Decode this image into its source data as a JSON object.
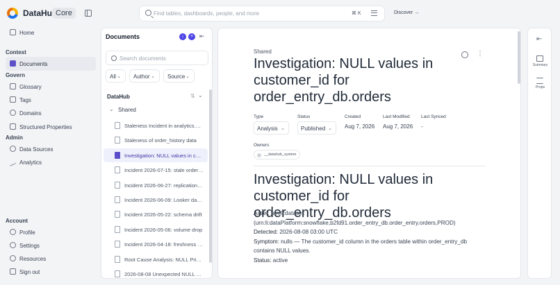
{
  "app": {
    "name": "DataHub",
    "edition": "Core"
  },
  "search": {
    "placeholder": "Find tables, dashboards, people, and more",
    "shortcut": "⌘ K"
  },
  "discover_label": "Discover →",
  "nav": {
    "home": "Home",
    "context_label": "Context",
    "documents": "Documents",
    "govern_label": "Govern",
    "glossary": "Glossary",
    "tags": "Tags",
    "domains": "Domains",
    "structured_properties": "Structured Properties",
    "admin_label": "Admin",
    "data_sources": "Data Sources",
    "analytics": "Analytics",
    "account_label": "Account",
    "profile": "Profile",
    "settings": "Settings",
    "resources": "Resources",
    "sign_out": "Sign out"
  },
  "docs_panel": {
    "title": "Documents",
    "search_placeholder": "Search documents",
    "filters": [
      "All",
      "Author",
      "Source"
    ],
    "tree_root": "DataHub",
    "folder": "Shared",
    "items": [
      {
        "label": "Staleness Incident in analytics.monthly_revenue",
        "active": false
      },
      {
        "label": "Staleness of order_history data",
        "active": false
      },
      {
        "label": "Investigation: NULL values in customer_id",
        "active": true
      },
      {
        "label": "Incident 2026-07-15: stale orders table",
        "active": false
      },
      {
        "label": "Incident 2026-06-27: replication lag",
        "active": false
      },
      {
        "label": "Incident 2026-06-09: Looker dashboard errors",
        "active": false
      },
      {
        "label": "Incident 2026-05-22: schema drift",
        "active": false
      },
      {
        "label": "Incident 2026-05-06: volume drop",
        "active": false
      },
      {
        "label": "Incident 2026-04-18: freshness check failed",
        "active": false
      },
      {
        "label": "Root Cause Analysis: NULL Pricing",
        "active": false
      },
      {
        "label": "2026-08-08 Unexpected NULL values",
        "active": false
      }
    ]
  },
  "document": {
    "breadcrumb": "Shared",
    "title": "Investigation: NULL values in customer_id for order_entry_db.orders",
    "type_label": "Type",
    "type_value": "Analysis",
    "status_label": "Status",
    "status_value": "Published",
    "created_label": "Created",
    "created_value": "Aug 7, 2026",
    "modified_label": "Last Modified",
    "modified_value": "Aug 7, 2026",
    "synced_label": "Last Synced",
    "synced_value": "-",
    "owners_label": "Owners",
    "owner": "__datahub_system",
    "heading": "Investigation: NULL values in customer_id for order_entry_db.orders",
    "asset_key": "Asset:",
    "asset_value": " urn:li:dataset:",
    "asset_value2": "(urn:li:dataPlatform:snowflake,b2fd91.order_entry_db.order_entry.orders,PROD)",
    "detected_key": "Detected:",
    "detected_value": " 2026-08-08 03:00 UTC",
    "symptom_key": "Symptom:",
    "symptom_value": " nulls — The customer_id column in the orders table within order_entry_db",
    "symptom_value2": "contains NULL values.",
    "status_key": "Status:",
    "status_body_value": " active"
  },
  "rail": {
    "summary": "Summary",
    "props": "Props"
  }
}
